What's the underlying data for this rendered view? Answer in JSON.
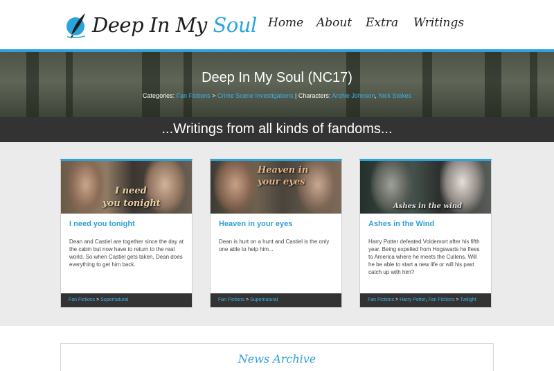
{
  "site": {
    "logo_text": "Deep In My",
    "logo_accent": "Soul"
  },
  "nav": [
    {
      "label": "Home"
    },
    {
      "label": "About"
    },
    {
      "label": "Extra"
    },
    {
      "label": "Writings"
    }
  ],
  "banner": {
    "title": "Deep In My Soul (NC17)",
    "categories_label": "Categories:",
    "category_1": "Fan Fictions",
    "category_sep": ">",
    "category_2": "Crime Scene Investigations",
    "characters_label": "| Characters:",
    "character_1": "Archie Johnson",
    "character_2": "Nick Stokes"
  },
  "tagline": "...Writings from all kinds of fandoms...",
  "cards": [
    {
      "image_caption_1": "I need",
      "image_caption_2": "you tonight",
      "title": "I need you tonight",
      "description": "Dean and Castiel are together since the day at the cabin but now have to return to the real world. So when Castiel gets taken, Dean does everything to get him back.",
      "cat_1": "Fan Fictions",
      "cat_2": "Supernatural"
    },
    {
      "image_caption_1": "Heaven in",
      "image_caption_2": "your eyes",
      "title": "Heaven in your eyes",
      "description": "Dean is hurt on a hunt and Castiel is the only one able to help him...",
      "cat_1": "Fan Fictions",
      "cat_2": "Supernatural"
    },
    {
      "image_caption_1": "Ashes in the wind",
      "title": "Ashes in the Wind",
      "description": "Harry Potter defeated Voldemort after his fifth year. Being expelled from Hogswarts he flees to America where he meets the Cullens. Will he be able to start a new life or will his past catch up with him?",
      "cat_1": "Fan Fictions",
      "cat_2": "Harry Potter",
      "cat_3": "Fan Fictions",
      "cat_4": "Twilight"
    }
  ],
  "news": {
    "title": "News Archive"
  },
  "colors": {
    "accent": "#2ea3d9",
    "dark_bar": "#333333"
  }
}
